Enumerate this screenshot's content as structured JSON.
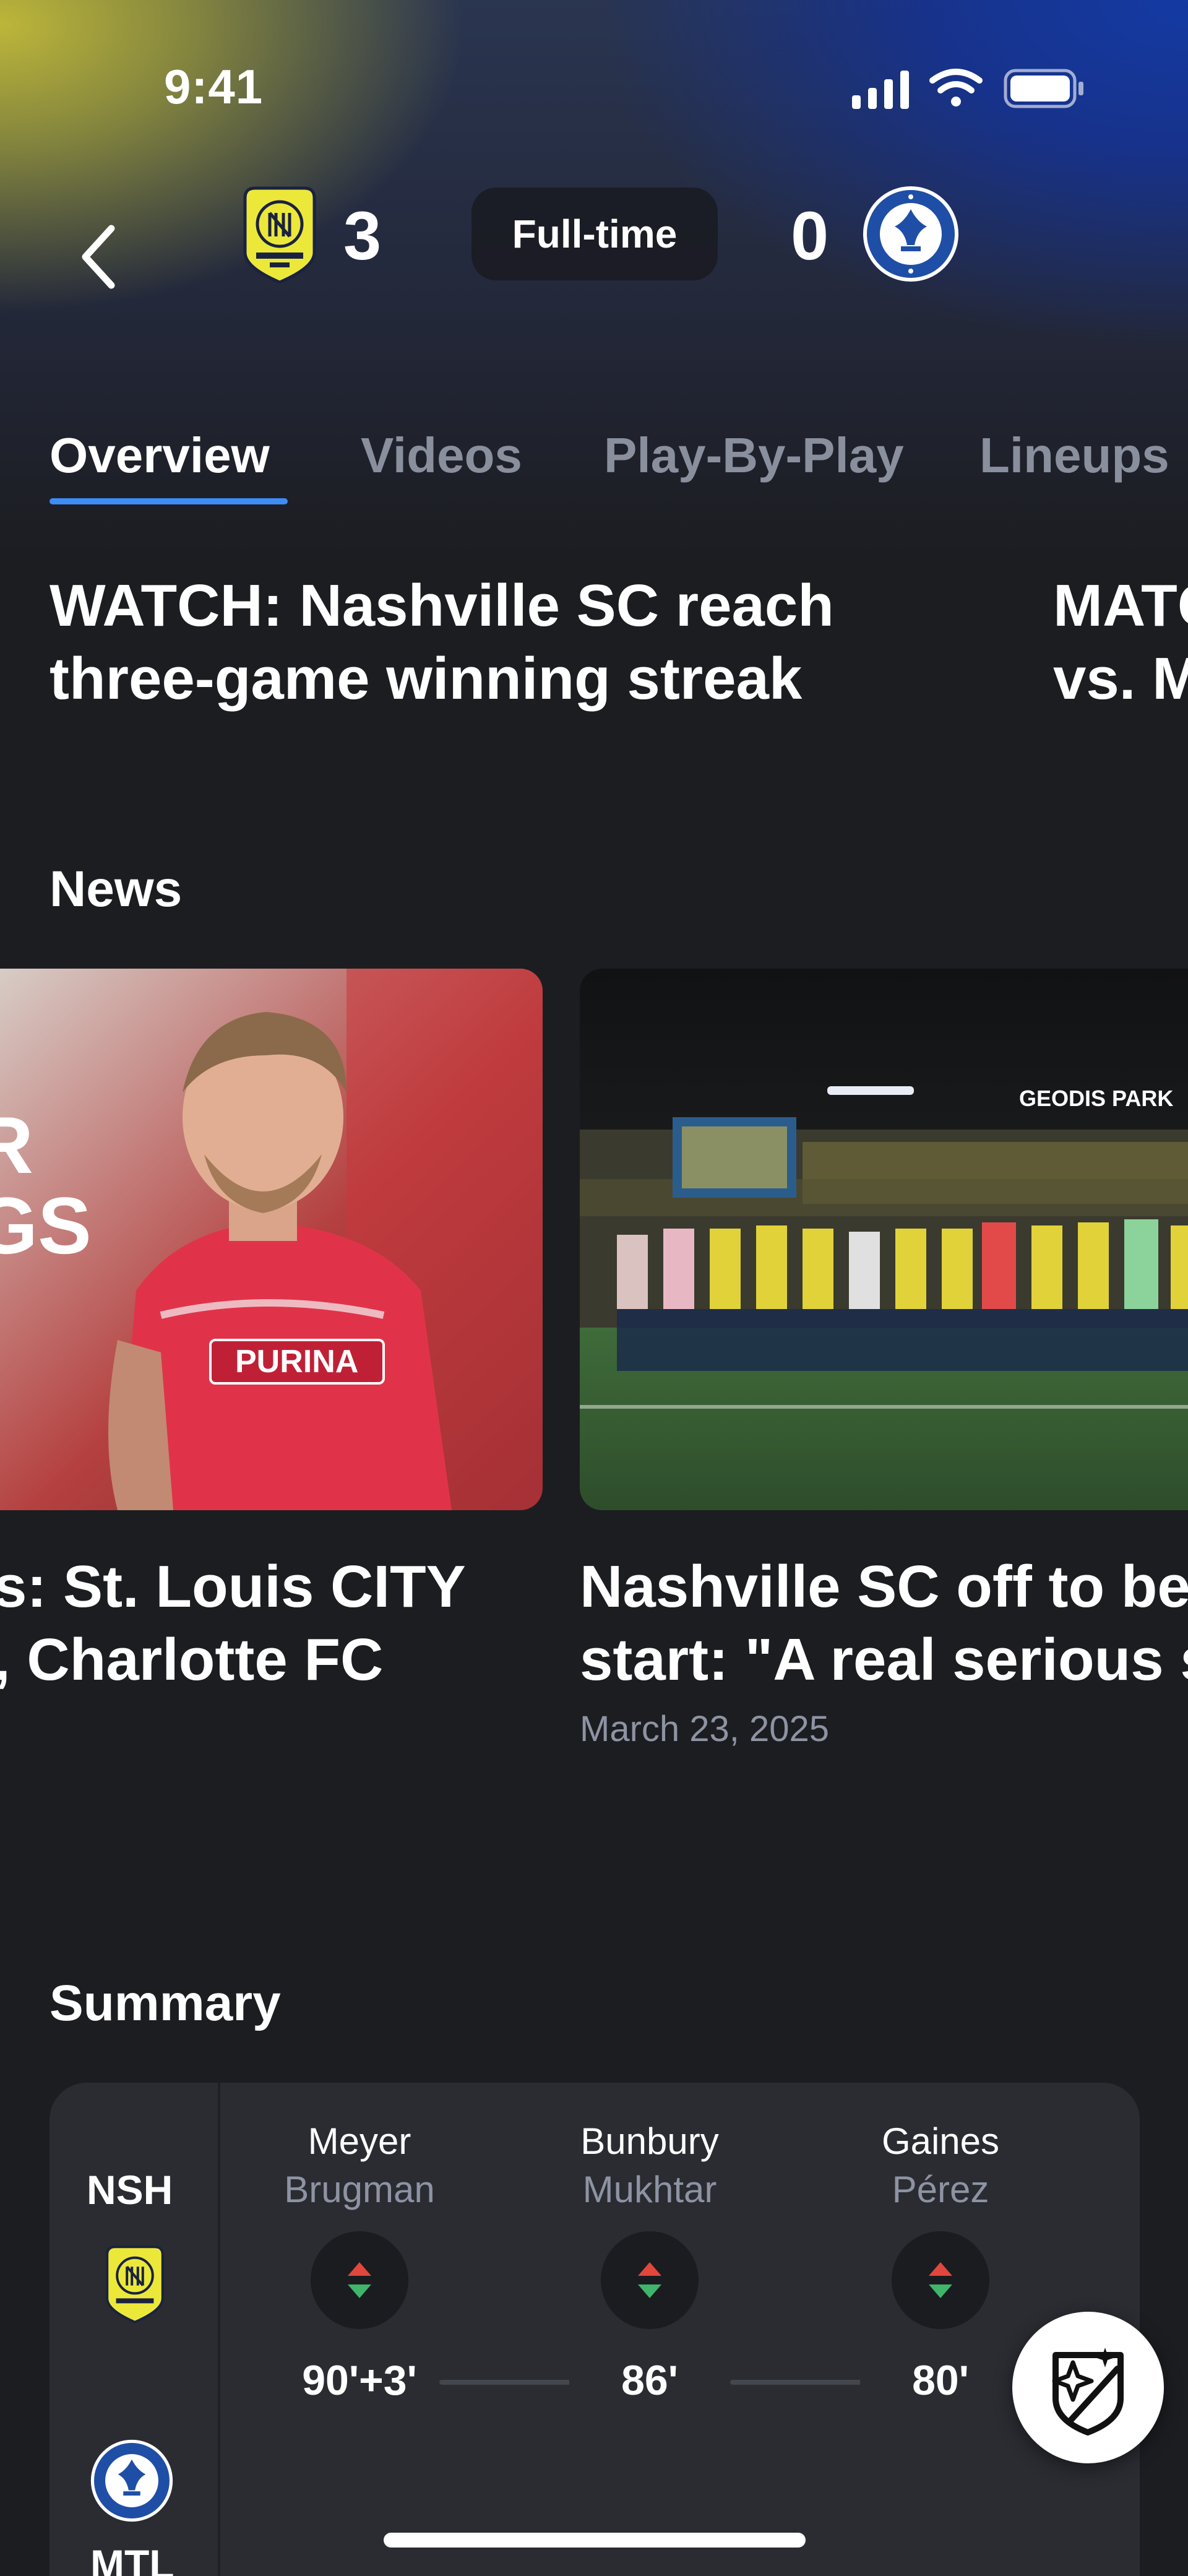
{
  "status_bar": {
    "time": "9:41"
  },
  "match": {
    "home": {
      "name": "Nashville SC",
      "score": "3",
      "crest_icon": "nashville-sc-crest"
    },
    "away": {
      "name": "CF Montréal",
      "score": "0",
      "crest_icon": "cf-montreal-crest"
    },
    "status": "Full-time"
  },
  "tabs": [
    {
      "label": "Overview",
      "active": true
    },
    {
      "label": "Videos",
      "active": false
    },
    {
      "label": "Play-By-Play",
      "active": false
    },
    {
      "label": "Lineups",
      "active": false
    }
  ],
  "videos": [
    {
      "line1": "WATCH: Nashville SC reach",
      "line2": "three-game winning streak"
    },
    {
      "line1": "MATC",
      "line2": "vs. M"
    }
  ],
  "news": {
    "heading": "News",
    "items": [
      {
        "line1": "s: St. Louis CITY",
        "line2": ", Charlotte FC",
        "image_text": "R\nGS",
        "jersey_text": "PURINA"
      },
      {
        "line1": "Nashville SC off to be",
        "line2": "start: \"A real serious s",
        "date": "March 23, 2025",
        "image_text": "GEODIS PARK"
      }
    ]
  },
  "summary": {
    "heading": "Summary",
    "teams": [
      {
        "abbr": "NSH",
        "crest_icon": "nashville-sc-crest"
      },
      {
        "abbr": "MTL",
        "crest_icon": "cf-montreal-crest"
      }
    ],
    "substitutions": [
      {
        "player_in": "Meyer",
        "player_out": "Brugman",
        "minute": "90'+3'",
        "icon": "substitution-arrows-icon"
      },
      {
        "player_in": "Bunbury",
        "player_out": "Mukhtar",
        "minute": "86'",
        "icon": "substitution-arrows-icon"
      },
      {
        "player_in": "Gaines",
        "player_out": "Pérez",
        "minute": "80'",
        "icon": "substitution-arrows-icon"
      }
    ]
  },
  "fab": {
    "icon": "mls-ai-assistant-icon"
  },
  "colors": {
    "background": "#1c1d21",
    "tab_active_underline": "#3d8df6",
    "tab_inactive": "#8a8f9e",
    "nashville_gold": "#ece83a",
    "montreal_blue": "#1f4ea6",
    "sub_in_arrow": "#e1473d",
    "sub_out_arrow": "#3fb56b"
  }
}
